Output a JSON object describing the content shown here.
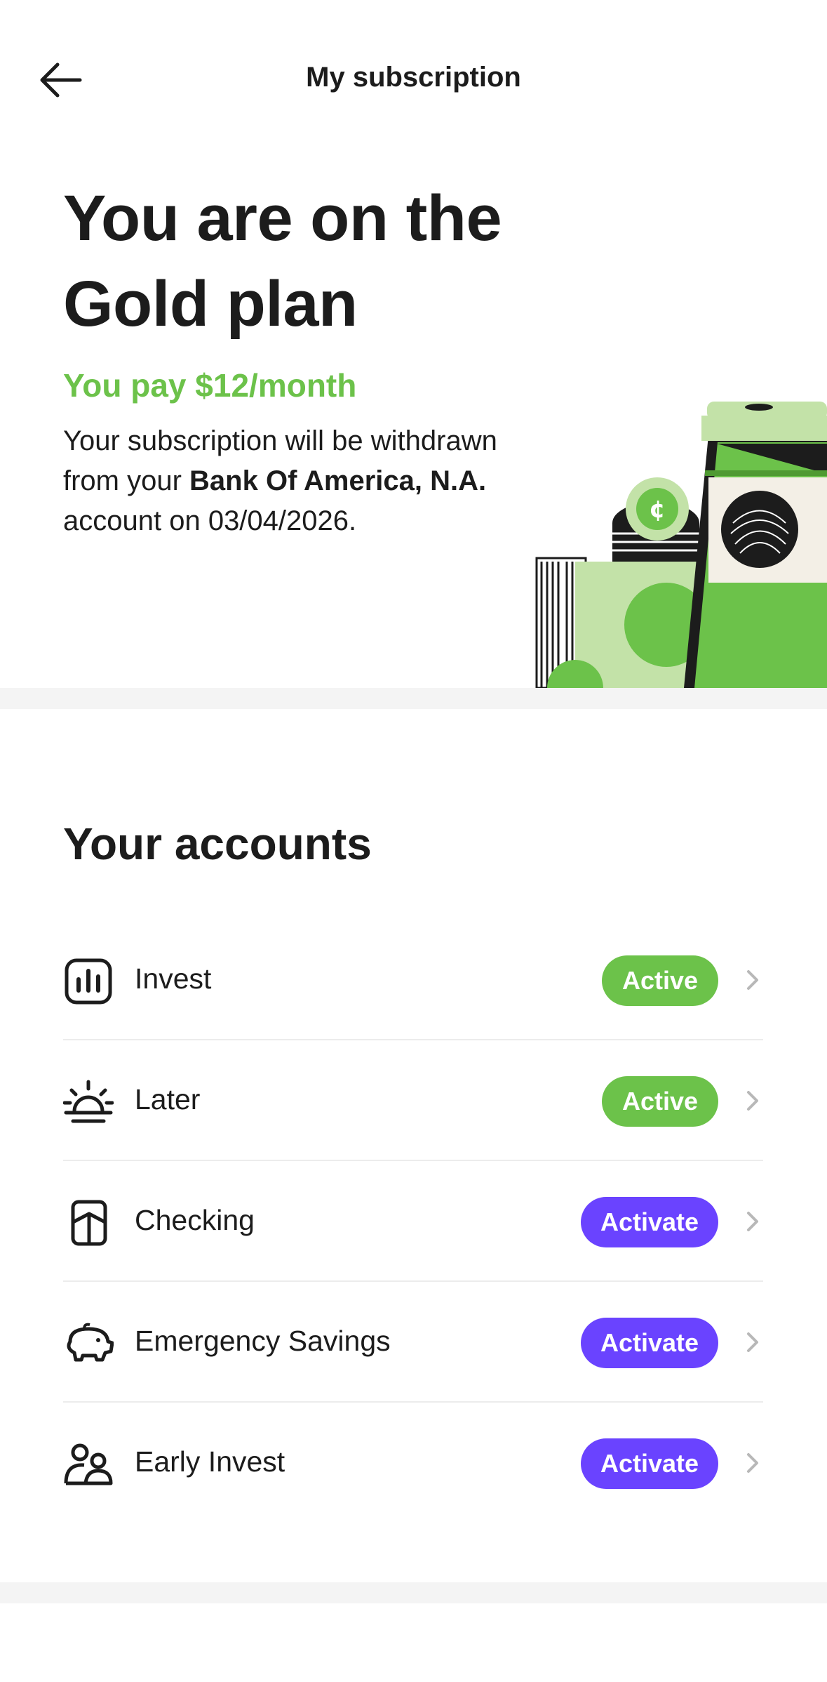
{
  "header": {
    "title": "My subscription",
    "back_icon": "arrow-left-icon"
  },
  "hero": {
    "headline": "You are on the Gold plan",
    "price": "You pay $12/month",
    "desc_prefix": "Your subscription will be withdrawn from your ",
    "bank": "Bank Of America, N.A.",
    "desc_suffix": " account on 03/04/2026.",
    "illustration": "coffee-cup-cash-illustration"
  },
  "accounts": {
    "title": "Your accounts",
    "items": [
      {
        "label": "Invest",
        "status": "Active",
        "icon": "bar-chart-icon"
      },
      {
        "label": "Later",
        "status": "Active",
        "icon": "sunrise-icon"
      },
      {
        "label": "Checking",
        "status": "Activate",
        "icon": "card-icon"
      },
      {
        "label": "Emergency Savings",
        "status": "Activate",
        "icon": "piggy-bank-icon"
      },
      {
        "label": "Early Invest",
        "status": "Activate",
        "icon": "family-icon"
      }
    ]
  },
  "colors": {
    "green": "#6cc24a",
    "purple": "#6a43ff",
    "text": "#1c1c1c"
  }
}
